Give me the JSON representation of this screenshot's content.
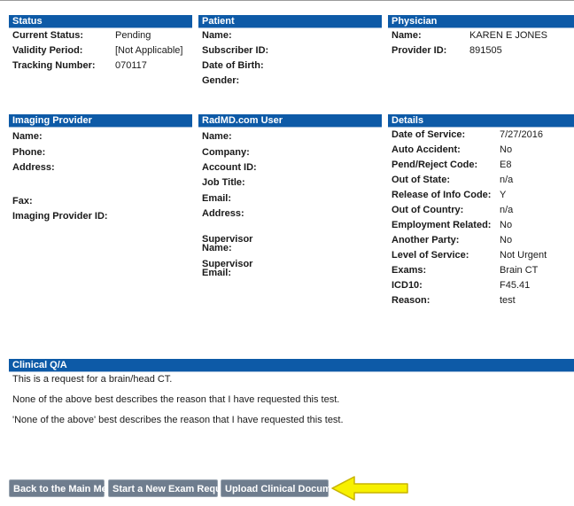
{
  "status": {
    "title": "Status",
    "rows": [
      {
        "label": "Current Status:",
        "value": "Pending"
      },
      {
        "label": "Validity Period:",
        "value": "[Not Applicable]"
      },
      {
        "label": "Tracking Number:",
        "value": "070117"
      }
    ]
  },
  "patient": {
    "title": "Patient",
    "rows": [
      {
        "label": "Name:",
        "value": ""
      },
      {
        "label": "Subscriber ID:",
        "value": ""
      },
      {
        "label": "Date of Birth:",
        "value": ""
      },
      {
        "label": "Gender:",
        "value": ""
      }
    ]
  },
  "physician": {
    "title": "Physician",
    "rows": [
      {
        "label": "Name:",
        "value": "KAREN E JONES"
      },
      {
        "label": "Provider ID:",
        "value": "891505"
      }
    ]
  },
  "imaging_provider": {
    "title": "Imaging Provider",
    "name_label": "Name:",
    "phone_label": "Phone:",
    "address_label": "Address:",
    "fax_label": "Fax:",
    "id_label": "Imaging Provider ID:"
  },
  "radmd_user": {
    "title": "RadMD.com User",
    "name_label": "Name:",
    "company_label": "Company:",
    "account_label": "Account ID:",
    "jobtitle_label": "Job Title:",
    "email_label": "Email:",
    "address_label": "Address:",
    "sup_name_line1": "Supervisor",
    "sup_name_line2": "Name:",
    "sup_email_line1": "Supervisor",
    "sup_email_line2": "Email:"
  },
  "details": {
    "title": "Details",
    "rows": [
      {
        "label": "Date of Service:",
        "value": "7/27/2016"
      },
      {
        "label": "Auto Accident:",
        "value": "No"
      },
      {
        "label": "Pend/Reject Code:",
        "value": "E8"
      },
      {
        "label": "Out of State:",
        "value": "n/a"
      },
      {
        "label": "Release of Info Code:",
        "value": "Y"
      },
      {
        "label": "Out of Country:",
        "value": "n/a"
      },
      {
        "label": "Employment Related:",
        "value": "No"
      },
      {
        "label": "Another Party:",
        "value": "No"
      },
      {
        "label": "Level of Service:",
        "value": "Not Urgent"
      },
      {
        "label": "Exams:",
        "value": "Brain CT"
      },
      {
        "label": "ICD10:",
        "value": "F45.41"
      },
      {
        "label": "Reason:",
        "value": "test"
      }
    ]
  },
  "clinical_qa": {
    "title": "Clinical Q/A",
    "lines": [
      "This is a request for a brain/head CT.",
      "None of the above best describes the reason that I have requested this test.",
      "'None of the above' best describes the reason that I have requested this test."
    ]
  },
  "buttons": {
    "main_menu": "Back to the Main Menu",
    "new_exam": "Start a New Exam Request",
    "upload": "Upload Clinical Document"
  },
  "annotation": {
    "arrow_color": "#f7f000",
    "arrow_stroke": "#c8b400",
    "arrow_icon": "arrow-left"
  },
  "colors": {
    "header_bg": "#0d5aa7",
    "button_bg": "#6f7d8e"
  }
}
